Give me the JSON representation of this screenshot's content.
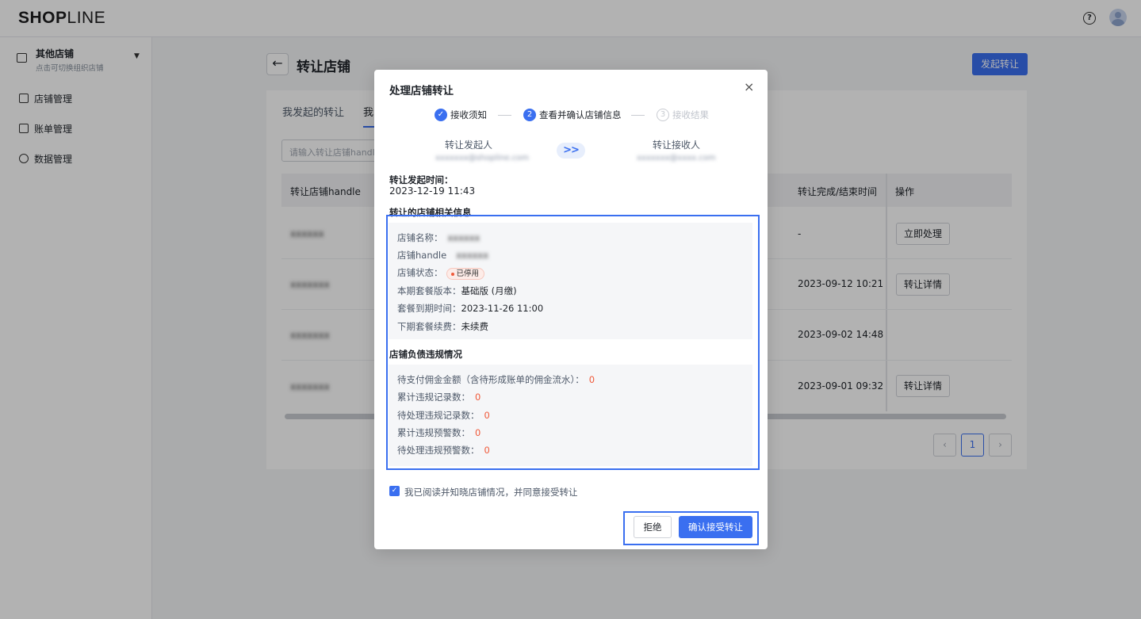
{
  "app": {
    "logo_bold": "SHOP",
    "logo_thin": "LINE"
  },
  "sidebar": {
    "store_name": "其他店铺",
    "store_hint": "点击可切换组织店铺",
    "items": [
      {
        "label": "店铺管理",
        "icon": "store-icon"
      },
      {
        "label": "账单管理",
        "icon": "bill-icon"
      },
      {
        "label": "数据管理",
        "icon": "gauge-icon"
      }
    ]
  },
  "page": {
    "title": "转让店铺",
    "start_button": "发起转让",
    "tabs": [
      "我发起的转让",
      "我"
    ],
    "search_placeholder": "请输入转让店铺handle",
    "columns": {
      "handle": "转让店铺handle",
      "end_time": "转让完成/结束时间",
      "op": "操作"
    },
    "rows": [
      {
        "handle": "xxxxxx",
        "end_time": "-",
        "op": "立即处理"
      },
      {
        "handle": "xxxxxxx",
        "end_time": "2023-09-12 10:21",
        "op": "转让详情"
      },
      {
        "handle": "xxxxxxx",
        "end_time": "2023-09-02 14:48",
        "op": ""
      },
      {
        "handle": "xxxxxxx",
        "end_time": "2023-09-01 09:32",
        "op": "转让详情"
      }
    ],
    "pagination": {
      "prev": "‹",
      "current": "1",
      "next": "›"
    }
  },
  "modal": {
    "title": "处理店铺转让",
    "close": "×",
    "steps": [
      {
        "num": "✓",
        "label": "接收须知"
      },
      {
        "num": "2",
        "label": "查看并确认店铺信息"
      },
      {
        "num": "3",
        "label": "接收结果"
      }
    ],
    "from_label": "转让发起人",
    "from_email": "xxxxxxx@shopline.com",
    "arrow": ">>",
    "to_label": "转让接收人",
    "to_email": "xxxxxxx@xxxx.com",
    "initiated_label": "转让发起时间：",
    "initiated_value": "2023-12-19 11:43",
    "store_info_heading": "转让的店铺相关信息",
    "store_info": {
      "name_key": "店铺名称：",
      "name_val": "xxxxxx",
      "handle_key": "店铺handle",
      "handle_val": "xxxxxx",
      "status_key": "店铺状态：",
      "status_val": "已停用",
      "plan_key": "本期套餐版本：",
      "plan_val": "基础版 (月缴)",
      "expire_key": "套餐到期时间：",
      "expire_val": "2023-11-26 11:00",
      "renew_key": "下期套餐续费：",
      "renew_val": "未续费"
    },
    "debt_heading": "店铺负债违规情况",
    "debt": [
      {
        "key": "待支付佣金金额（含待形成账单的佣金流水）：",
        "val": "0"
      },
      {
        "key": "累计违规记录数：",
        "val": "0"
      },
      {
        "key": "待处理违规记录数：",
        "val": "0"
      },
      {
        "key": "累计违规预警数：",
        "val": "0"
      },
      {
        "key": "待处理违规预警数：",
        "val": "0"
      }
    ],
    "agree_label": "我已阅读并知晓店铺情况，并同意接受转让",
    "reject": "拒绝",
    "confirm": "确认接受转让"
  },
  "colors": {
    "accent": "#3a6ff0",
    "danger": "#f05a3a"
  }
}
